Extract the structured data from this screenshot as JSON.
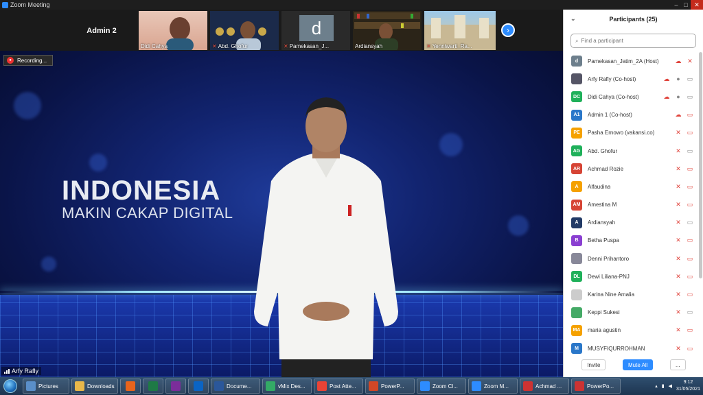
{
  "window": {
    "title": "Zoom Meeting"
  },
  "gallery": {
    "admin_tile": "Admin 2",
    "tiles": [
      {
        "name": "Didi Cahya",
        "muted": false
      },
      {
        "name": "Abd. Ghofur",
        "muted": true
      },
      {
        "name": "Pamekasan_J...",
        "muted": true,
        "initial": "d"
      },
      {
        "name": "Ardiansyah",
        "muted": false
      },
      {
        "name": "Yenniwarti_Ra...",
        "muted": true
      }
    ]
  },
  "video": {
    "recording_label": "Recording...",
    "brand_line1": "INDONESIA",
    "brand_line2": "MAKIN CAKAP DIGITAL",
    "active_speaker": "Arfy Rafly"
  },
  "participants": {
    "title": "Participants (25)",
    "search_placeholder": "Find a participant",
    "list": [
      {
        "name": "Pamekasan_Jatim_2A (Host)",
        "initials": "d",
        "color": "#6d7f8c"
      },
      {
        "name": "Arfy Rafly (Co-host)",
        "initials": "",
        "color": "#556"
      },
      {
        "name": "Didi Cahya (Co-host)",
        "initials": "DC",
        "color": "#1fb05a"
      },
      {
        "name": "Admin 1 (Co-host)",
        "initials": "A1",
        "color": "#2a77c9"
      },
      {
        "name": "Pasha Ernowo (vakansi.co)",
        "initials": "PE",
        "color": "#f5a100"
      },
      {
        "name": "Abd. Ghofur",
        "initials": "AG",
        "color": "#1fb05a"
      },
      {
        "name": "Achmad Rozie",
        "initials": "AR",
        "color": "#d64435"
      },
      {
        "name": "Alfaudina",
        "initials": "A",
        "color": "#f5a100"
      },
      {
        "name": "Amestina M",
        "initials": "AM",
        "color": "#d64435"
      },
      {
        "name": "Ardiansyah",
        "initials": "A",
        "color": "#223a66"
      },
      {
        "name": "Betha Puspa",
        "initials": "B",
        "color": "#8a3fd1"
      },
      {
        "name": "Denni Prihantoro",
        "initials": "",
        "color": "#889"
      },
      {
        "name": "Dewi Liliana-PNJ",
        "initials": "DL",
        "color": "#1fb05a"
      },
      {
        "name": "Karina Nine Amalia",
        "initials": "",
        "color": "#ccc"
      },
      {
        "name": "Keppi Sukesi",
        "initials": "",
        "color": "#4a6"
      },
      {
        "name": "maria agustin",
        "initials": "MA",
        "color": "#f5a100"
      },
      {
        "name": "MUSYFIQURROHMAN",
        "initials": "M",
        "color": "#2a77c9"
      }
    ],
    "invite_label": "Invite",
    "mute_all_label": "Mute All",
    "more_label": "..."
  },
  "taskbar": {
    "items": [
      {
        "label": "Pictures",
        "color": "#5a8fc9"
      },
      {
        "label": "Downloads",
        "color": "#e8b84a"
      },
      {
        "label": "",
        "color": "#e8641c"
      },
      {
        "label": "",
        "color": "#1e7a45"
      },
      {
        "label": "",
        "color": "#7b2d9a"
      },
      {
        "label": "",
        "color": "#0a64c4"
      },
      {
        "label": "Docume...",
        "color": "#2b579a"
      },
      {
        "label": "vMix Des...",
        "color": "#3a6"
      },
      {
        "label": "Post Atte...",
        "color": "#ea4335"
      },
      {
        "label": "PowerP...",
        "color": "#d24726"
      },
      {
        "label": "Zoom Cl...",
        "color": "#2d8cff"
      },
      {
        "label": "Zoom M...",
        "color": "#2d8cff"
      },
      {
        "label": "Achmad ...",
        "color": "#c33"
      },
      {
        "label": "PowerPo...",
        "color": "#c33"
      }
    ],
    "time": "9:12",
    "date": "31/05/2021"
  }
}
